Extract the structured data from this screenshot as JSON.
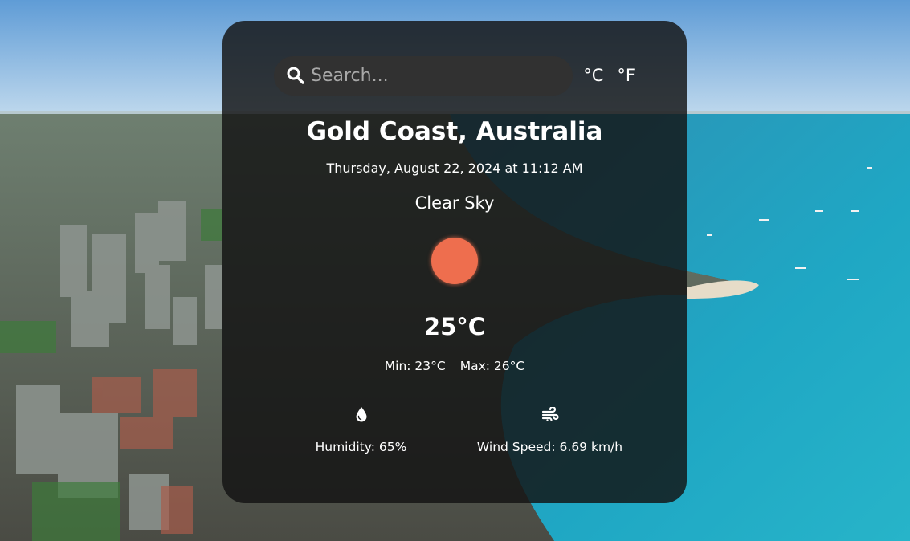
{
  "search": {
    "placeholder": "Search...",
    "value": ""
  },
  "units": {
    "celsius_label": "°C",
    "fahrenheit_label": "°F"
  },
  "weather": {
    "city": "Gold Coast, Australia",
    "datetime": "Thursday, August 22, 2024 at 11:12 AM",
    "condition": "Clear Sky",
    "condition_icon": "sun-icon",
    "temperature": "25°C",
    "min": "Min: 23°C",
    "max": "Max: 26°C"
  },
  "stats": {
    "humidity": {
      "icon": "droplet-icon",
      "label": "Humidity: 65%"
    },
    "wind": {
      "icon": "wind-icon",
      "label": "Wind Speed: 6.69 km/h"
    }
  },
  "colors": {
    "card_bg": "#121212",
    "search_bg": "#313131",
    "sun": "#ee6e4e",
    "text": "#ffffff"
  }
}
